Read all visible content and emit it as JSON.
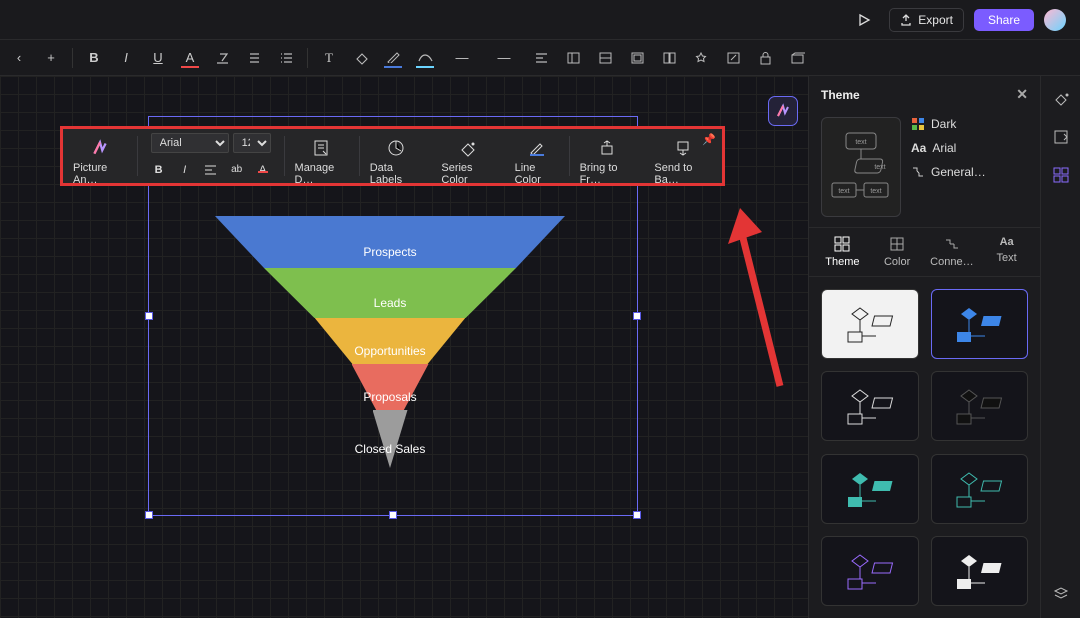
{
  "topbar": {
    "export_label": "Export",
    "share_label": "Share"
  },
  "formatbar": {
    "add": "+",
    "bold": "B",
    "italic": "I",
    "underline": "U",
    "fontcolor": "A",
    "text": "T",
    "dash1": "—",
    "dash2": "—"
  },
  "ctx": {
    "picture_btn": "Picture An…",
    "font_family": "Arial",
    "font_size": "12",
    "manage": "Manage D…",
    "data_labels": "Data Labels",
    "series_color": "Series Color",
    "line_color": "Line Color",
    "bring_front": "Bring to Fr…",
    "send_back": "Send to Ba…"
  },
  "chart_data": {
    "type": "funnel",
    "stages": [
      {
        "label": "Prospects",
        "color": "#4a79d1"
      },
      {
        "label": "Leads",
        "color": "#7ebf4e"
      },
      {
        "label": "Opportunities",
        "color": "#ebb53e"
      },
      {
        "label": "Proposals",
        "color": "#e86c5f"
      },
      {
        "label": "Closed Sales",
        "color": "#9c9c9c"
      }
    ]
  },
  "panel": {
    "title": "Theme",
    "preview": {
      "scheme_label": "Dark",
      "font_label": "Arial",
      "layout_label": "General…"
    },
    "tabs": {
      "theme": "Theme",
      "color": "Color",
      "connect": "Conne…",
      "text": "Text"
    }
  }
}
